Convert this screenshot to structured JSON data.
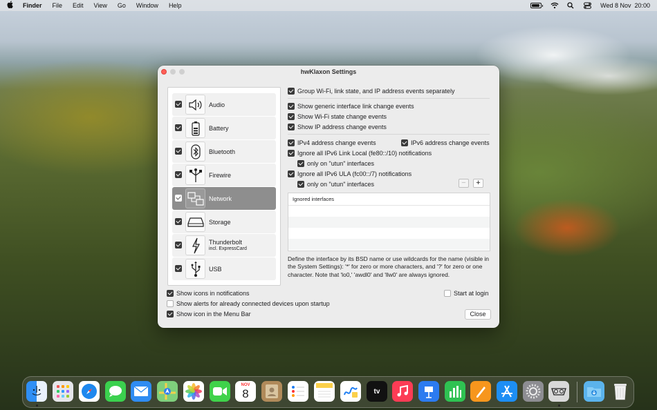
{
  "menubar": {
    "app": "Finder",
    "items": [
      "File",
      "Edit",
      "View",
      "Go",
      "Window",
      "Help"
    ],
    "clock": "Wed 8 Nov  20:00"
  },
  "window": {
    "title": "hwKlaxon Settings",
    "devices": [
      {
        "label": "Audio",
        "checked": true,
        "icon": "speaker-icon"
      },
      {
        "label": "Battery",
        "checked": true,
        "icon": "battery-icon"
      },
      {
        "label": "Bluetooth",
        "checked": true,
        "icon": "bluetooth-icon"
      },
      {
        "label": "Firewire",
        "checked": true,
        "icon": "firewire-icon"
      },
      {
        "label": "Network",
        "checked": true,
        "selected": true,
        "icon": "network-icon"
      },
      {
        "label": "Storage",
        "checked": true,
        "icon": "drive-icon"
      },
      {
        "label": "Thunderbolt",
        "sublabel": "incl. ExpressCard",
        "checked": true,
        "icon": "thunderbolt-icon"
      },
      {
        "label": "USB",
        "checked": true,
        "icon": "usb-icon"
      }
    ],
    "options": {
      "group_events": "Group Wi-Fi, link state, and IP address events separately",
      "link_change": "Show generic interface link change events",
      "wifi_change": "Show Wi-Fi state change events",
      "ip_change": "Show IP address change events",
      "ipv4_change": "IPv4 address change events",
      "ipv6_change": "IPv6 address change events",
      "ignore_link_local": "Ignore all IPv6 Link Local (fe80::/10) notifications",
      "only_utun_1": "only on \"utun\" interfaces",
      "ignore_ula": "Ignore all IPv6 ULA (fc00::/7) notifications",
      "only_utun_2": "only on \"utun\" interfaces"
    },
    "ignored_table": {
      "header": "Ignored interfaces",
      "rows": [],
      "remove_label": "−",
      "add_label": "+"
    },
    "help_text": "Define the interface by its BSD name or use wildcards for the name (visible in the System Settings): '*' for zero or more characters, and '?' for zero or one character. Note that 'lo0,' 'awdl0' and 'llw0' are always ignored.",
    "bottom": {
      "show_icons": "Show icons in notifications",
      "show_alerts": "Show alerts for already connected devices upon startup",
      "show_menubar": "Show icon in the Menu Bar",
      "start_login": "Start at login",
      "close": "Close"
    }
  },
  "dock": {
    "calendar_month": "NOV",
    "calendar_day": "8",
    "tv_label": "tv"
  },
  "colors": {
    "close": "#fe5f57",
    "selected_row": "#8e8e8e"
  }
}
